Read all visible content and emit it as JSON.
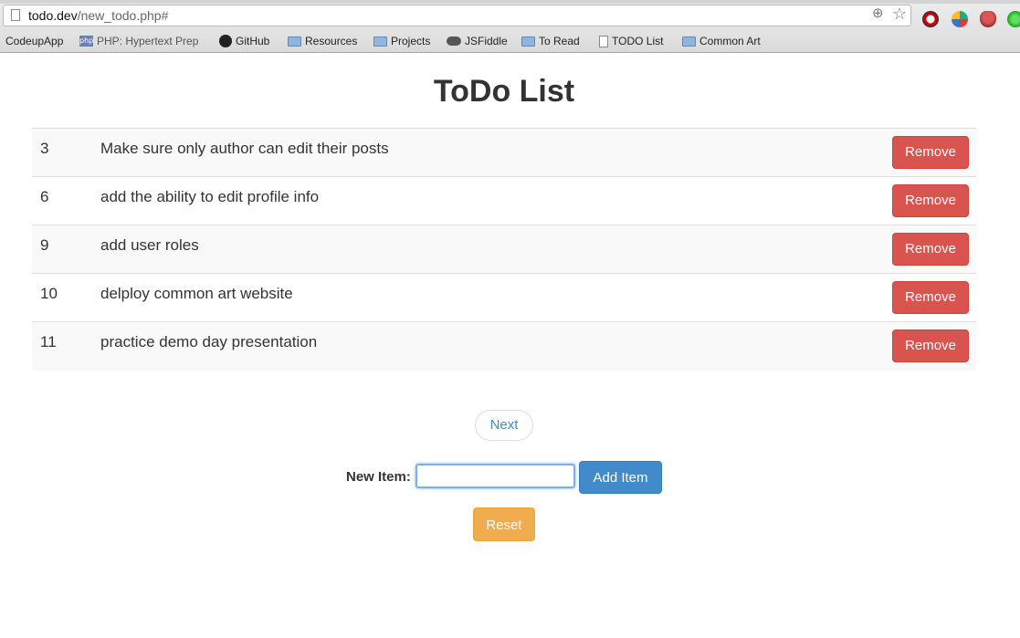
{
  "browser": {
    "url_host": "todo.dev",
    "url_path": "/new_todo.php#",
    "bookmarks": [
      {
        "label": "CodeupApp",
        "icon": "none"
      },
      {
        "label": "PHP: Hypertext Prep",
        "icon": "php-icon"
      },
      {
        "label": "GitHub",
        "icon": "github-icon"
      },
      {
        "label": "Resources",
        "icon": "folder-icon"
      },
      {
        "label": "Projects",
        "icon": "folder-icon"
      },
      {
        "label": "JSFiddle",
        "icon": "jsfiddle-icon"
      },
      {
        "label": "To Read",
        "icon": "folder-icon"
      },
      {
        "label": "TODO List",
        "icon": "page-icon"
      },
      {
        "label": "Common Art",
        "icon": "folder-icon"
      }
    ],
    "extension_icons": [
      "news-icon",
      "globe-icon",
      "octopus-icon",
      "green-circle-icon"
    ]
  },
  "page": {
    "title": "ToDo List"
  },
  "todos": [
    {
      "id": "3",
      "text": "Make sure only author can edit their posts",
      "action": "Remove"
    },
    {
      "id": "6",
      "text": "add the ability to edit profile info",
      "action": "Remove"
    },
    {
      "id": "9",
      "text": "add user roles",
      "action": "Remove"
    },
    {
      "id": "10",
      "text": "delploy common art website",
      "action": "Remove"
    },
    {
      "id": "11",
      "text": "practice demo day presentation",
      "action": "Remove"
    }
  ],
  "pagination": {
    "next_label": "Next"
  },
  "form": {
    "label": "New Item:",
    "input_value": "",
    "add_label": "Add Item",
    "reset_label": "Reset"
  },
  "colors": {
    "danger": "#d9534f",
    "primary": "#428bca",
    "warning": "#f0ad4e",
    "link": "#428bca"
  }
}
